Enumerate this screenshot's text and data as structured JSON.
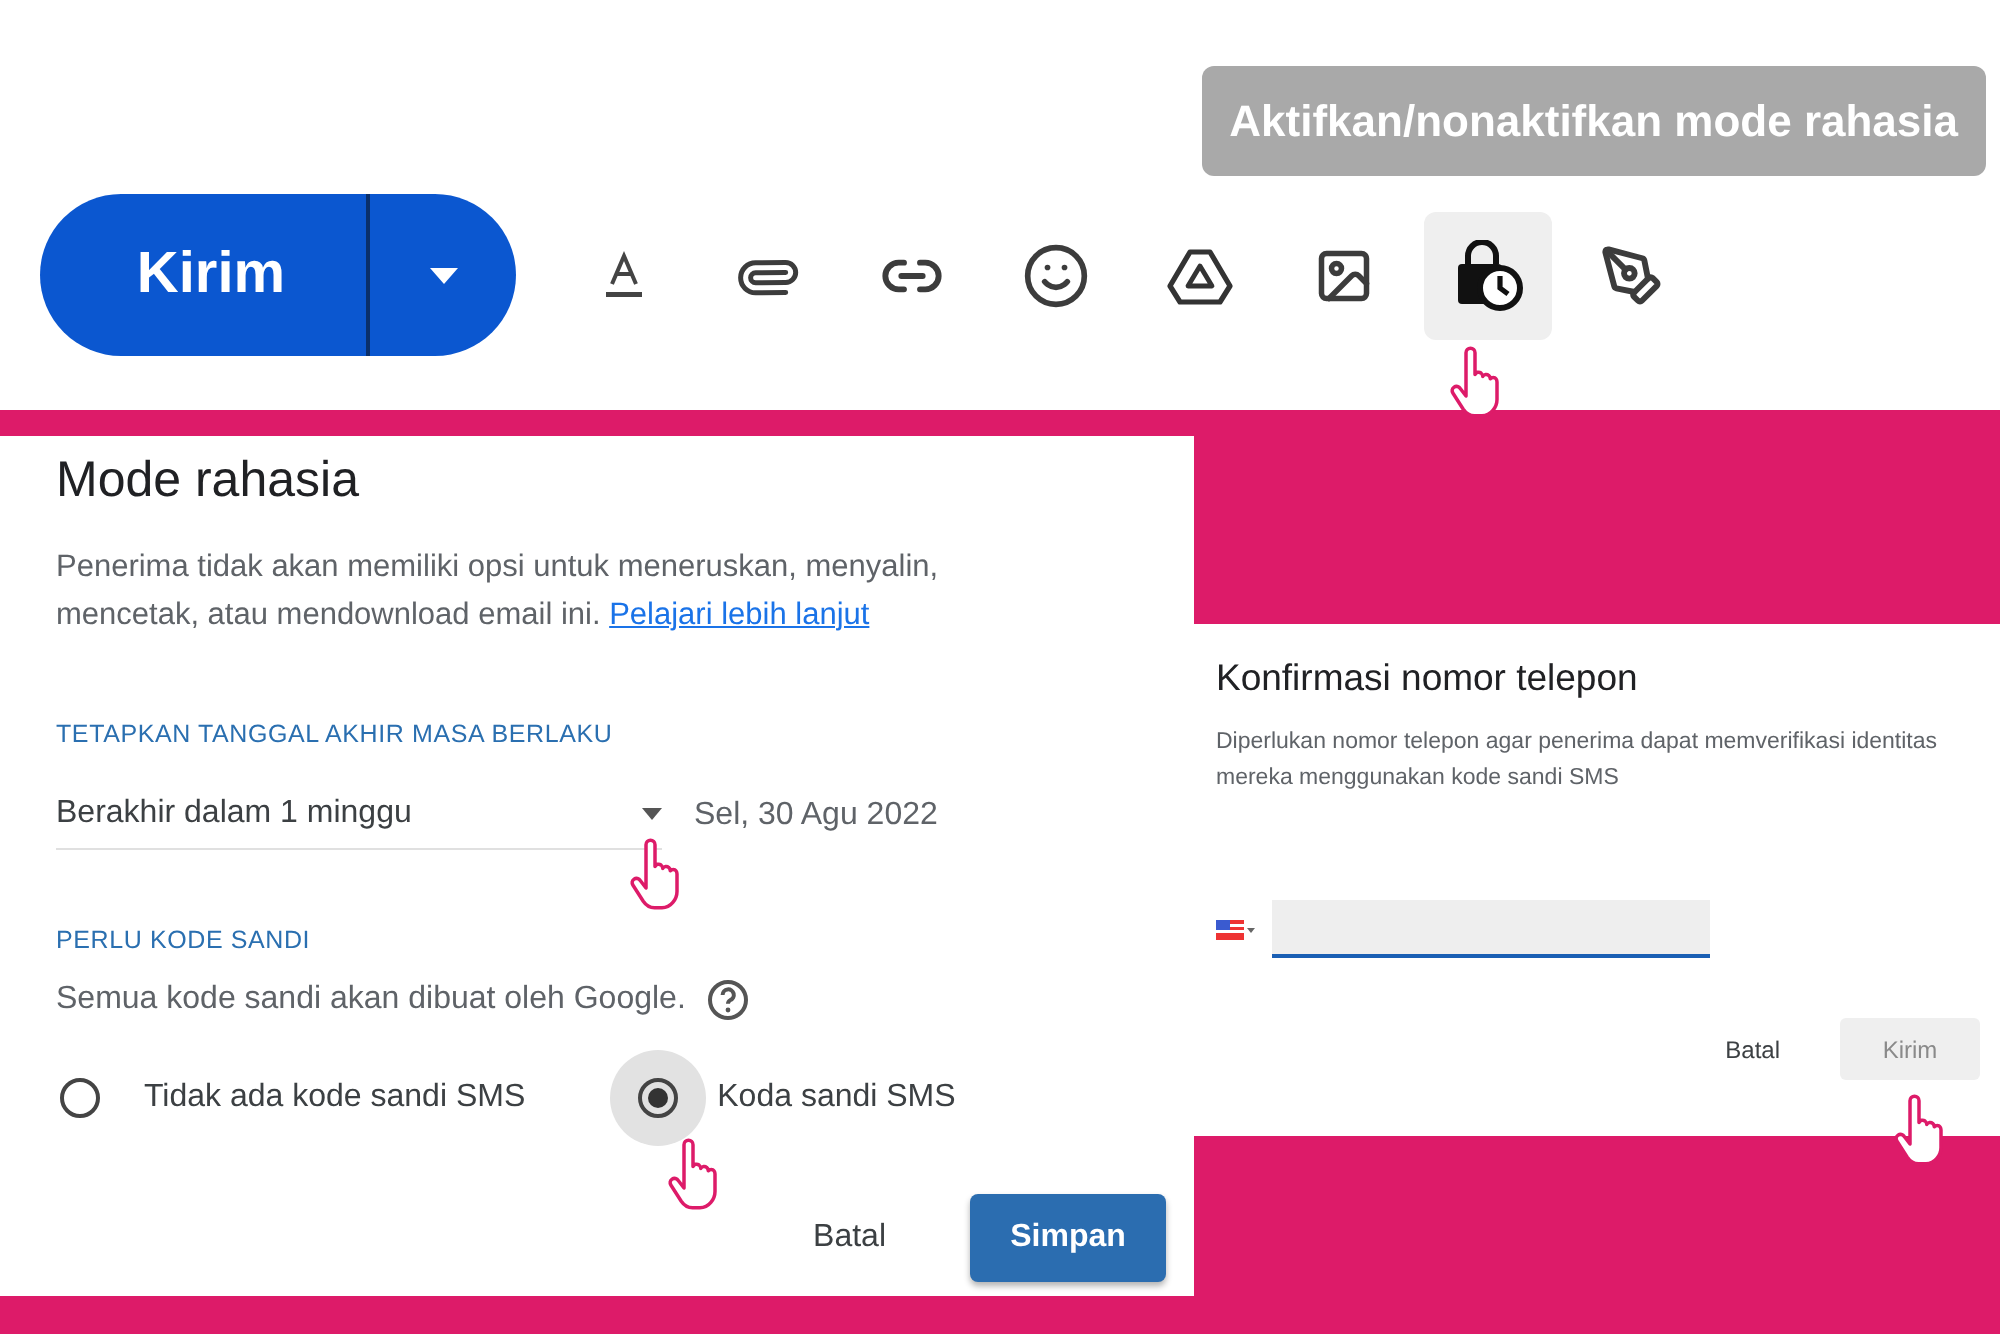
{
  "compose_toolbar": {
    "tooltip": "Aktifkan/nonaktifkan mode rahasia",
    "send_button": "Kirim",
    "tools": [
      {
        "kind": "format",
        "selected": false
      },
      {
        "kind": "attach",
        "selected": false
      },
      {
        "kind": "link",
        "selected": false
      },
      {
        "kind": "emoji",
        "selected": false
      },
      {
        "kind": "drive",
        "selected": false
      },
      {
        "kind": "photo",
        "selected": false
      },
      {
        "kind": "confidential",
        "selected": true
      },
      {
        "kind": "signature",
        "selected": false
      }
    ]
  },
  "confidential_dialog": {
    "title": "Mode rahasia",
    "description": "Penerima tidak akan memiliki opsi untuk meneruskan, menyalin, mencetak, atau mendownload email ini.",
    "link": "Pelajari lebih lanjut",
    "expiry_heading": "TETAPKAN TANGGAL AKHIR MASA BERLAKU",
    "expiry_option": "Berakhir dalam 1 minggu",
    "expiry_date": "Sel, 30 Agu 2022",
    "passcode_heading": "PERLU KODE SANDI",
    "passcode_note": "Semua kode sandi akan dibuat oleh Google.",
    "passcode_options": [
      {
        "label": "Tidak ada kode sandi SMS",
        "selected": false
      },
      {
        "label": "Koda sandi SMS",
        "selected": true
      }
    ],
    "cancel_button": "Batal",
    "save_button": "Simpan"
  },
  "phone_dialog": {
    "title": "Konfirmasi nomor telepon",
    "description": "Diperlukan nomor telepon agar penerima dapat memverifikasi identitas mereka menggunakan kode sandi SMS",
    "cancel_button": "Batal",
    "send_button": "Kirim",
    "send_disabled": true
  }
}
